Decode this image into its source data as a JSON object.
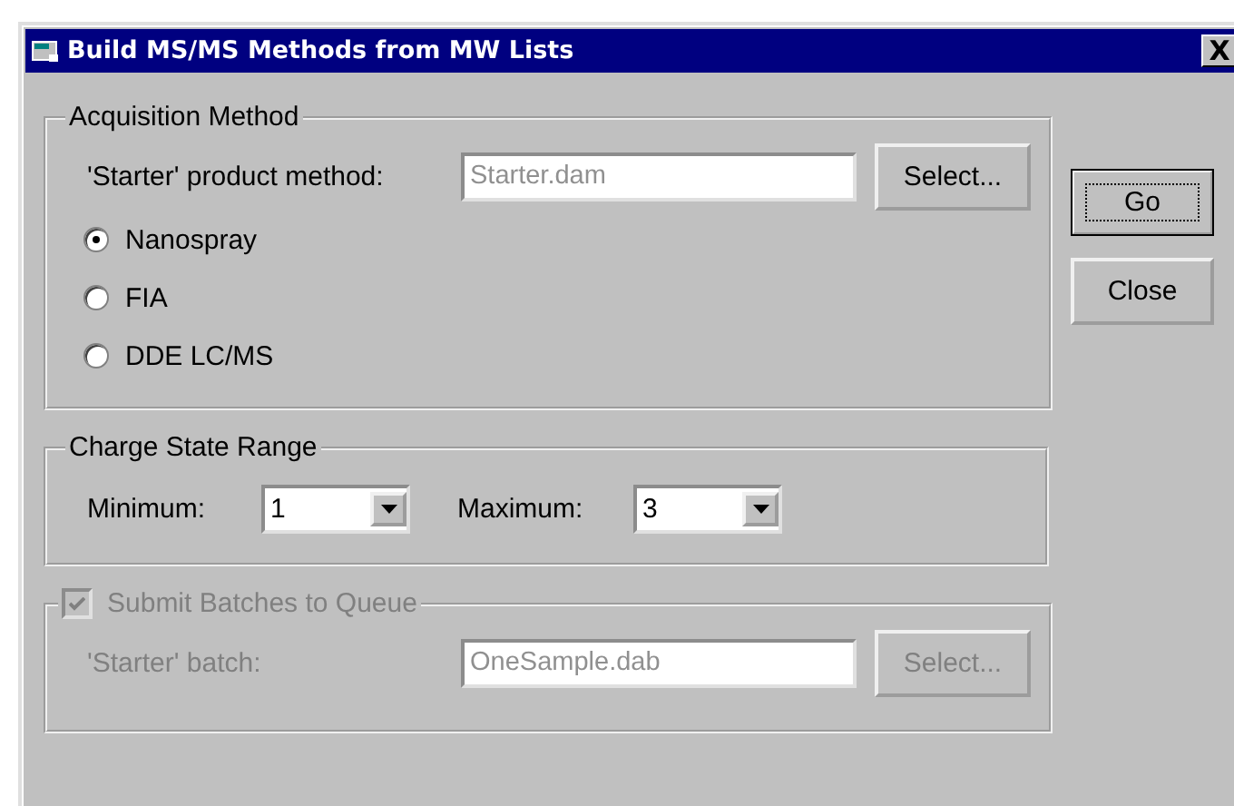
{
  "window": {
    "title": "Build MS/MS Methods from MW Lists",
    "close_glyph": "X"
  },
  "acquisition": {
    "title": "Acquisition Method",
    "method_label": "'Starter' product method:",
    "method_value": "Starter.dam",
    "select_button": "Select...",
    "options": [
      {
        "label": "Nanospray",
        "selected": true
      },
      {
        "label": "FIA",
        "selected": false
      },
      {
        "label": "DDE LC/MS",
        "selected": false
      }
    ]
  },
  "charge_range": {
    "title": "Charge State Range",
    "minimum_label": "Minimum:",
    "minimum_value": "1",
    "maximum_label": "Maximum:",
    "maximum_value": "3"
  },
  "submit": {
    "title": "Submit Batches to Queue",
    "checked": true,
    "disabled": true,
    "batch_label": "'Starter' batch:",
    "batch_value": "OneSample.dab",
    "select_button": "Select..."
  },
  "buttons": [
    {
      "label": "Go",
      "default": true
    },
    {
      "label": "Close",
      "default": false
    }
  ]
}
